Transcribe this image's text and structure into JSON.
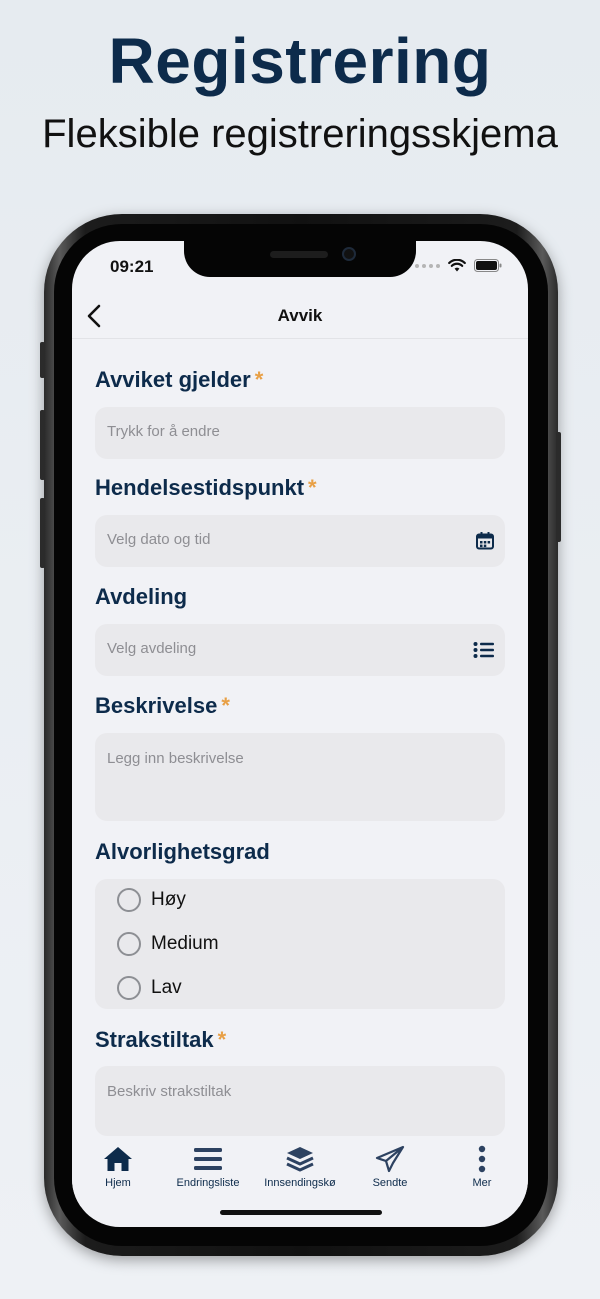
{
  "promo": {
    "title": "Registrering",
    "subtitle": "Fleksible registreringsskjema"
  },
  "status_bar": {
    "time": "09:21"
  },
  "nav": {
    "title": "Avvik",
    "back_icon": "chevron-left-icon"
  },
  "form": {
    "fields": [
      {
        "label": "Avviket gjelder",
        "required": "*",
        "placeholder": "Trykk for å endre"
      },
      {
        "label": "Hendelsestidspunkt",
        "required": "*",
        "placeholder": "Velg dato og tid",
        "icon": "calendar-icon"
      },
      {
        "label": "Avdeling",
        "placeholder": "Velg avdeling",
        "icon": "list-icon"
      },
      {
        "label": "Beskrivelse",
        "required": "*",
        "placeholder": "Legg inn beskrivelse"
      },
      {
        "label": "Alvorlighetsgrad",
        "options": [
          "Høy",
          "Medium",
          "Lav"
        ]
      },
      {
        "label": "Strakstiltak",
        "required": "*",
        "placeholder": "Beskriv strakstiltak"
      }
    ]
  },
  "tabbar": {
    "tabs": [
      {
        "label": "Hjem",
        "icon": "home-icon"
      },
      {
        "label": "Endringsliste",
        "icon": "bars-icon"
      },
      {
        "label": "Innsendingskø",
        "icon": "layers-icon"
      },
      {
        "label": "Sendte",
        "icon": "paper-plane-icon"
      },
      {
        "label": "Mer",
        "icon": "more-vertical-icon"
      }
    ]
  },
  "colors": {
    "brand_navy": "#0d2b4b",
    "required_orange": "#e8a046",
    "field_bg": "#e9e9ec",
    "screen_bg": "#f1f2f6"
  }
}
